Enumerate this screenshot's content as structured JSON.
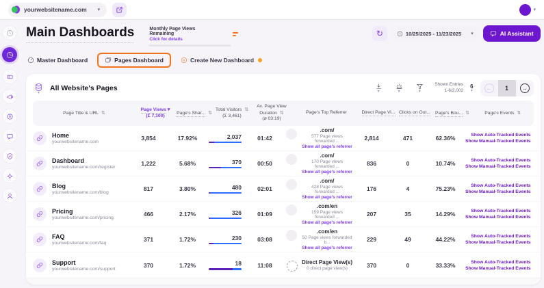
{
  "colors": {
    "brand_purple": "#6d16cf",
    "link_purple": "#7c3aed",
    "highlight_orange": "#f2711c",
    "bar_purple": "#5b21b6",
    "bar_blue": "#2e6bff"
  },
  "topbar": {
    "website": "yourwebsitename.com"
  },
  "sidebar": {
    "icons": [
      "clock-icon",
      "dashboards-icon",
      "ticket-icon",
      "megaphone-icon",
      "radar-icon",
      "chat-icon",
      "badge-icon",
      "gear-icon",
      "user-icon"
    ],
    "active_index": 1
  },
  "header": {
    "title": "Main Dashboards",
    "usage_label": "Monthly Page Views Remaining",
    "usage_link": "Click for details",
    "date_range": "10/25/2025 - 11/23/2025",
    "ai_assistant": "AI Assistant"
  },
  "tabs": [
    {
      "label": "Master Dashboard"
    },
    {
      "label": "Pages Dashboard"
    },
    {
      "label": "Create New Dashboard"
    }
  ],
  "card": {
    "title": "All Website's Pages",
    "shown_entries_label": "Shown Entries",
    "shown_entries_value": "1-6/2,002",
    "page_size": "6",
    "current_page": "1",
    "columns": [
      {
        "label": "Page Title & URL"
      },
      {
        "label": "Page Views",
        "sub": "(Σ 7,100)"
      },
      {
        "label": "Page's Shar..."
      },
      {
        "label": "Total Visitors",
        "sub": "(Σ 3,461)"
      },
      {
        "label": "Av. Page View Duration",
        "sub": "(⌀ 03:19)"
      },
      {
        "label": "Page's Top Referrer"
      },
      {
        "label": "Direct Page Vi..."
      },
      {
        "label": "Clicks on Out..."
      },
      {
        "label": "Page's Bou..."
      },
      {
        "label": "Page's Events"
      }
    ],
    "events_links": {
      "auto": "Show Auto-Tracked Events",
      "manual": "Show Manual-Tracked Events"
    },
    "referrer_link": "Show all page's referrer",
    "rows": [
      {
        "title": "Home",
        "url": "yourwebsitename.com",
        "views": "3,854",
        "share": "17.92%",
        "visitors": "2,037",
        "bar_purple_fraction": 0.16,
        "duration": "01:42",
        "ref_name": ".com/",
        "ref_note": "577 Page views forwarded ...",
        "has_ref_link": true,
        "dashed_favicon": false,
        "direct": "2,814",
        "clicks": "471",
        "bounce": "62.36%"
      },
      {
        "title": "Dashboard",
        "url": "yourwebsitename.com/register",
        "views": "1,222",
        "share": "5.68%",
        "visitors": "370",
        "bar_purple_fraction": 0.38,
        "duration": "00:50",
        "ref_name": ".com/",
        "ref_note": "170 Page views forwarded ...",
        "has_ref_link": true,
        "dashed_favicon": false,
        "direct": "836",
        "clicks": "0",
        "bounce": "10.74%"
      },
      {
        "title": "Blog",
        "url": "yourwebsitename.com/blog",
        "views": "817",
        "share": "3.80%",
        "visitors": "480",
        "bar_purple_fraction": 0.05,
        "duration": "02:01",
        "ref_name": ".com/",
        "ref_note": "428 Page views forwarded ...",
        "has_ref_link": true,
        "dashed_favicon": false,
        "direct": "176",
        "clicks": "4",
        "bounce": "75.23%"
      },
      {
        "title": "Pricing",
        "url": "yourwebsitename.com/pricing",
        "views": "466",
        "share": "2.17%",
        "visitors": "326",
        "bar_purple_fraction": 0.05,
        "duration": "01:09",
        "ref_name": ".com/en",
        "ref_note": "159 Page views forwarded ...",
        "has_ref_link": true,
        "dashed_favicon": false,
        "direct": "207",
        "clicks": "35",
        "bounce": "14.29%"
      },
      {
        "title": "FAQ",
        "url": "yourwebsitename.com/faq",
        "views": "371",
        "share": "1.72%",
        "visitors": "230",
        "bar_purple_fraction": 0.14,
        "duration": "03:08",
        "ref_name": ".com/en",
        "ref_note": "50 Page views forwarded b...",
        "has_ref_link": true,
        "dashed_favicon": false,
        "direct": "229",
        "clicks": "49",
        "bounce": "44.22%"
      },
      {
        "title": "Support",
        "url": "yourwebsitename.com/support",
        "views": "370",
        "share": "1.72%",
        "visitors": "18",
        "bar_purple_fraction": 0.72,
        "duration": "11:08",
        "ref_name": "Direct Page View(s)",
        "ref_note": "0 direct page view(s)",
        "has_ref_link": false,
        "dashed_favicon": true,
        "direct": "370",
        "clicks": "0",
        "bounce": "33.33%"
      }
    ]
  }
}
